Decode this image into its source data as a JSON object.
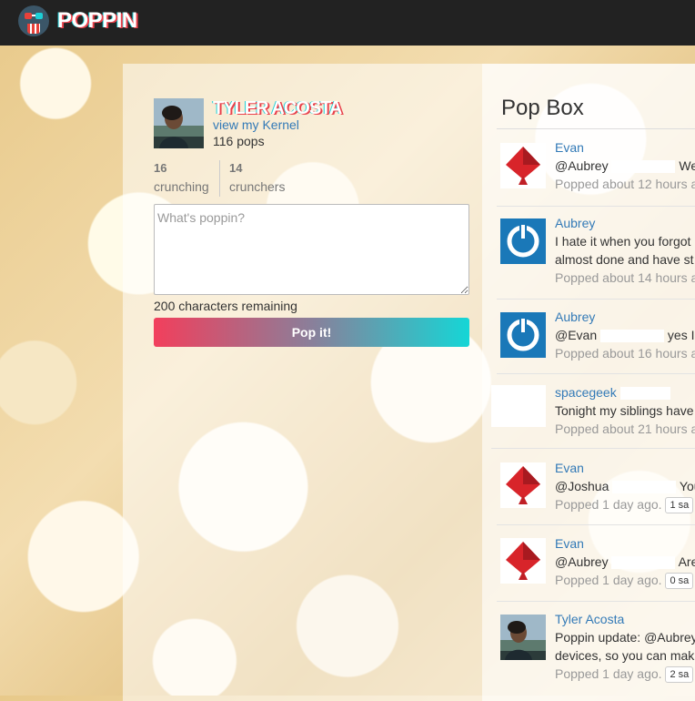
{
  "navbar": {
    "brand": "POPPIN",
    "logo_icon": "popcorn-mascot-icon"
  },
  "profile": {
    "name": "TYLER ACOSTA",
    "kernel_link": "view my Kernel",
    "pops": "116 pops",
    "crunching_count": "16",
    "crunching_label": "crunching",
    "crunchers_count": "14",
    "crunchers_label": "crunchers"
  },
  "composer": {
    "placeholder": "What's poppin?",
    "chars_remaining": "200 characters remaining",
    "button_label": "Pop it!"
  },
  "popbox": {
    "title": "Pop Box",
    "items": [
      {
        "user": "Evan",
        "line1_prefix": "@Aubrey",
        "line1_suffix": "Well now",
        "line2": "",
        "meta": "Popped about 12 hours a",
        "badge": "",
        "avatar": "red-diamond-icon"
      },
      {
        "user": "Aubrey",
        "line1_prefix": "I hate it when you forgot",
        "line1_suffix": "",
        "line2": "almost done and have st",
        "meta": "Popped about 14 hours a",
        "badge": "",
        "avatar": "power-icon"
      },
      {
        "user": "Aubrey",
        "line1_prefix": "@Evan",
        "line1_suffix": "yes I did g",
        "line2": "",
        "meta": "Popped about 16 hours a",
        "badge": "",
        "avatar": "power-icon"
      },
      {
        "user": "spacegeek",
        "line1_prefix": "Tonight my siblings have",
        "line1_suffix": "",
        "line2": "",
        "meta": "Popped about 21 hours a",
        "badge": "",
        "avatar": "blank-avatar"
      },
      {
        "user": "Evan",
        "line1_prefix": "@Joshua",
        "line1_suffix": "You're",
        "line2": "",
        "meta": "Popped 1 day ago.",
        "badge": "1 sa",
        "avatar": "red-diamond-icon"
      },
      {
        "user": "Evan",
        "line1_prefix": "@Aubrey",
        "line1_suffix": "Are you",
        "line2": "",
        "meta": "Popped 1 day ago.",
        "badge": "0 sa",
        "avatar": "red-diamond-icon"
      },
      {
        "user": "Tyler Acosta",
        "line1_prefix": "Poppin update: @Aubrey",
        "line1_suffix": "",
        "line2": "devices, so you can mak",
        "meta": "Popped 1 day ago.",
        "badge": "2 sa",
        "avatar": "user-photo"
      }
    ]
  }
}
